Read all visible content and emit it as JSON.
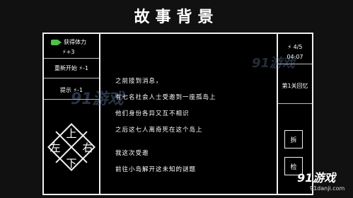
{
  "header": {
    "title": "故事背景"
  },
  "left_panel": {
    "stamina_label": "获得体力",
    "stamina_value": "+3",
    "restart_label": "重新开始",
    "restart_cost": "-1",
    "hint_label": "提示",
    "hint_cost": "-1",
    "dpad": {
      "up": "上",
      "down": "下",
      "left": "左",
      "right": "右"
    }
  },
  "story": {
    "lines": [
      "之前接到消息，",
      "有七名社会人士受邀到一座孤岛上",
      "他们身份各异又互不相识",
      "之后这七人离奇死在这个岛上",
      "我这次受邀",
      "前往小岛解开这未知的谜题"
    ]
  },
  "right_panel": {
    "energy": "4/5",
    "timer": "04:07",
    "chapter": "第1关回忆",
    "action_button": "拆",
    "action_button2": "检"
  },
  "watermarks": {
    "main": "91游戏",
    "url": "91danji.com",
    "mid": "91游戏",
    "mid_url": "91danji.com"
  },
  "icons": {
    "video": "video-icon",
    "bolt": "lightning-icon"
  },
  "colors": {
    "accent_green": "#4cc24c",
    "background": "#000000",
    "border": "#f0f0f0"
  }
}
